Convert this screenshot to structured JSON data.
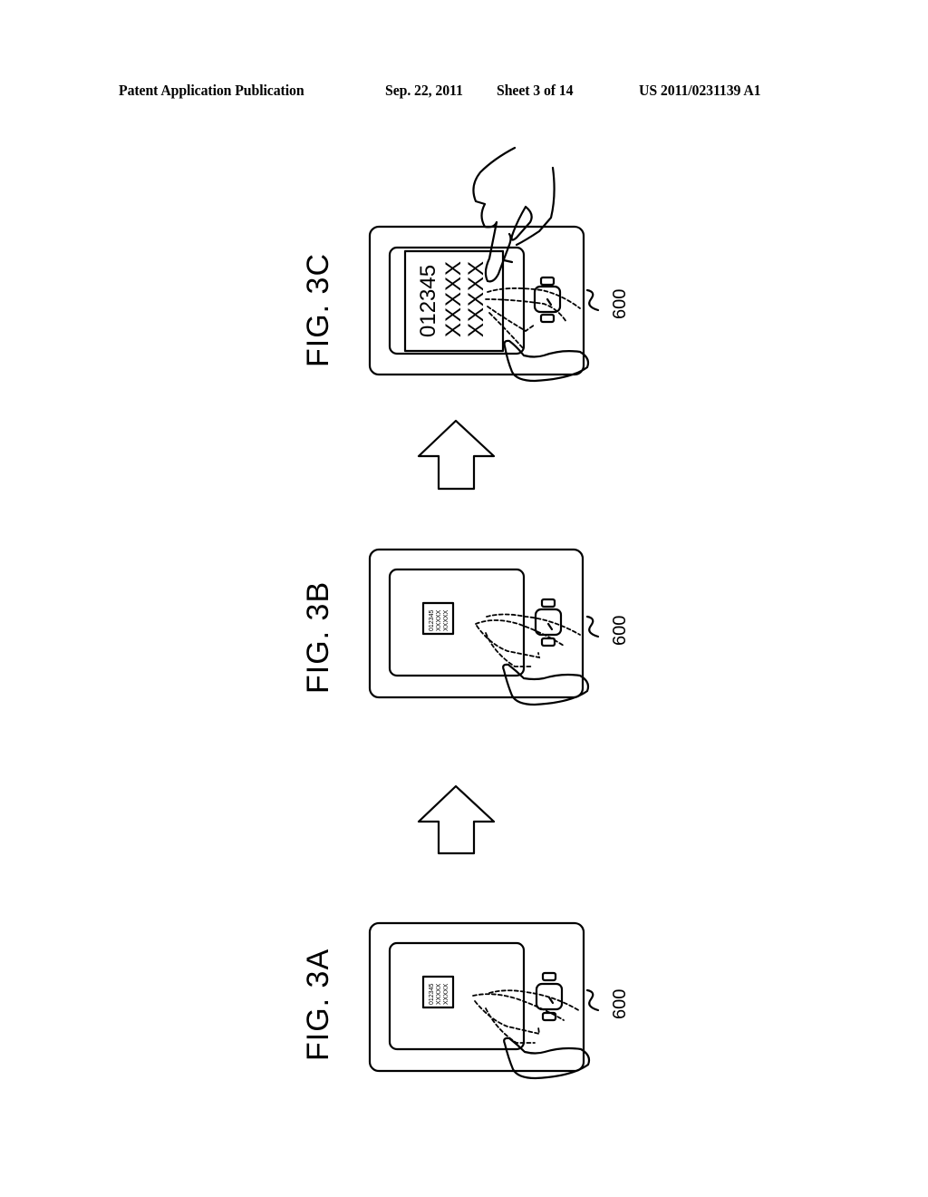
{
  "header": {
    "publication": "Patent Application Publication",
    "date": "Sep. 22, 2011",
    "sheet": "Sheet 3 of 14",
    "number": "US 2011/0231139 A1"
  },
  "figures": [
    {
      "label": "FIG. 3C",
      "reference": "600",
      "screen_lines": [
        "012345",
        "XXXXX",
        "XXXXX"
      ],
      "state": "enlarged content touched by finger"
    },
    {
      "label": "FIG. 3B",
      "reference": "600",
      "screen_lines": [
        "012345",
        "XXXXX",
        "XXXXX"
      ],
      "state": "small content, hand approaching"
    },
    {
      "label": "FIG. 3A",
      "reference": "600",
      "screen_lines": [
        "012345",
        "XXXXX",
        "XXXXX"
      ],
      "state": "small content, hand approaching"
    }
  ],
  "arrows": [
    {
      "direction": "up",
      "between": [
        "FIG. 3B",
        "FIG. 3C"
      ]
    },
    {
      "direction": "up",
      "between": [
        "FIG. 3A",
        "FIG. 3B"
      ]
    }
  ],
  "icons": {
    "arrow": "up-arrow-icon",
    "watch": "watch-icon",
    "hand": "hand-icon"
  }
}
